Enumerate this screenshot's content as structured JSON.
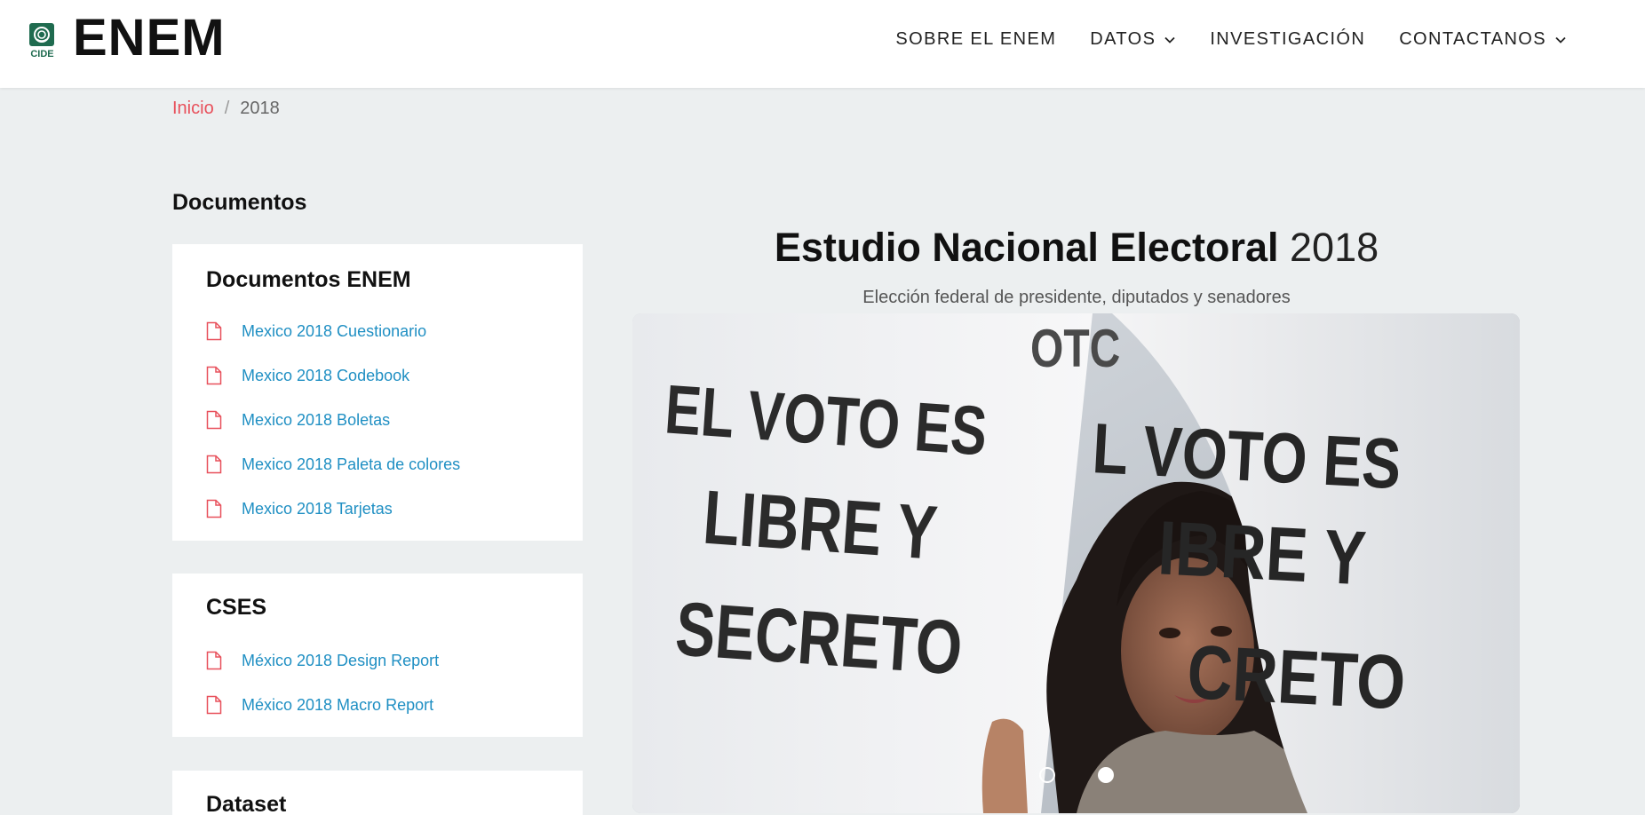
{
  "header": {
    "logo_caption": "CIDE",
    "brand": "ENEM",
    "nav": [
      {
        "label": "SOBRE EL ENEM",
        "has_dropdown": false
      },
      {
        "label": "DATOS",
        "has_dropdown": true
      },
      {
        "label": "INVESTIGACIÓN",
        "has_dropdown": false
      },
      {
        "label": "CONTACTANOS",
        "has_dropdown": true
      }
    ]
  },
  "breadcrumb": {
    "home": "Inicio",
    "separator": "/",
    "current": "2018"
  },
  "sidebar": {
    "heading": "Documentos",
    "cards": [
      {
        "title": "Documentos ENEM",
        "items": [
          "Mexico 2018 Cuestionario",
          "Mexico 2018 Codebook",
          "Mexico 2018 Boletas",
          "Mexico 2018 Paleta de colores",
          "Mexico 2018 Tarjetas"
        ]
      },
      {
        "title": "CSES",
        "items": [
          "México 2018 Design Report",
          "México 2018 Macro Report"
        ]
      },
      {
        "title": "Dataset",
        "items": []
      }
    ]
  },
  "main": {
    "title_bold": "Estudio Nacional Electoral",
    "title_year": "2018",
    "subtitle": "Elección federal de presidente, diputados y senadores",
    "carousel": {
      "slide_text_left": [
        "EL VOTO ES",
        "LIBRE Y",
        "SECRETO"
      ],
      "slide_text_right": [
        "OTC",
        "L VOTO ES",
        "IBRE Y",
        "CRETO"
      ],
      "active_slide": 2,
      "slide_count": 2
    }
  },
  "colors": {
    "accent_red": "#e8505b",
    "link_blue": "#1f8fc3",
    "page_bg": "#eceff0",
    "cide_green": "#1f6b4f"
  }
}
